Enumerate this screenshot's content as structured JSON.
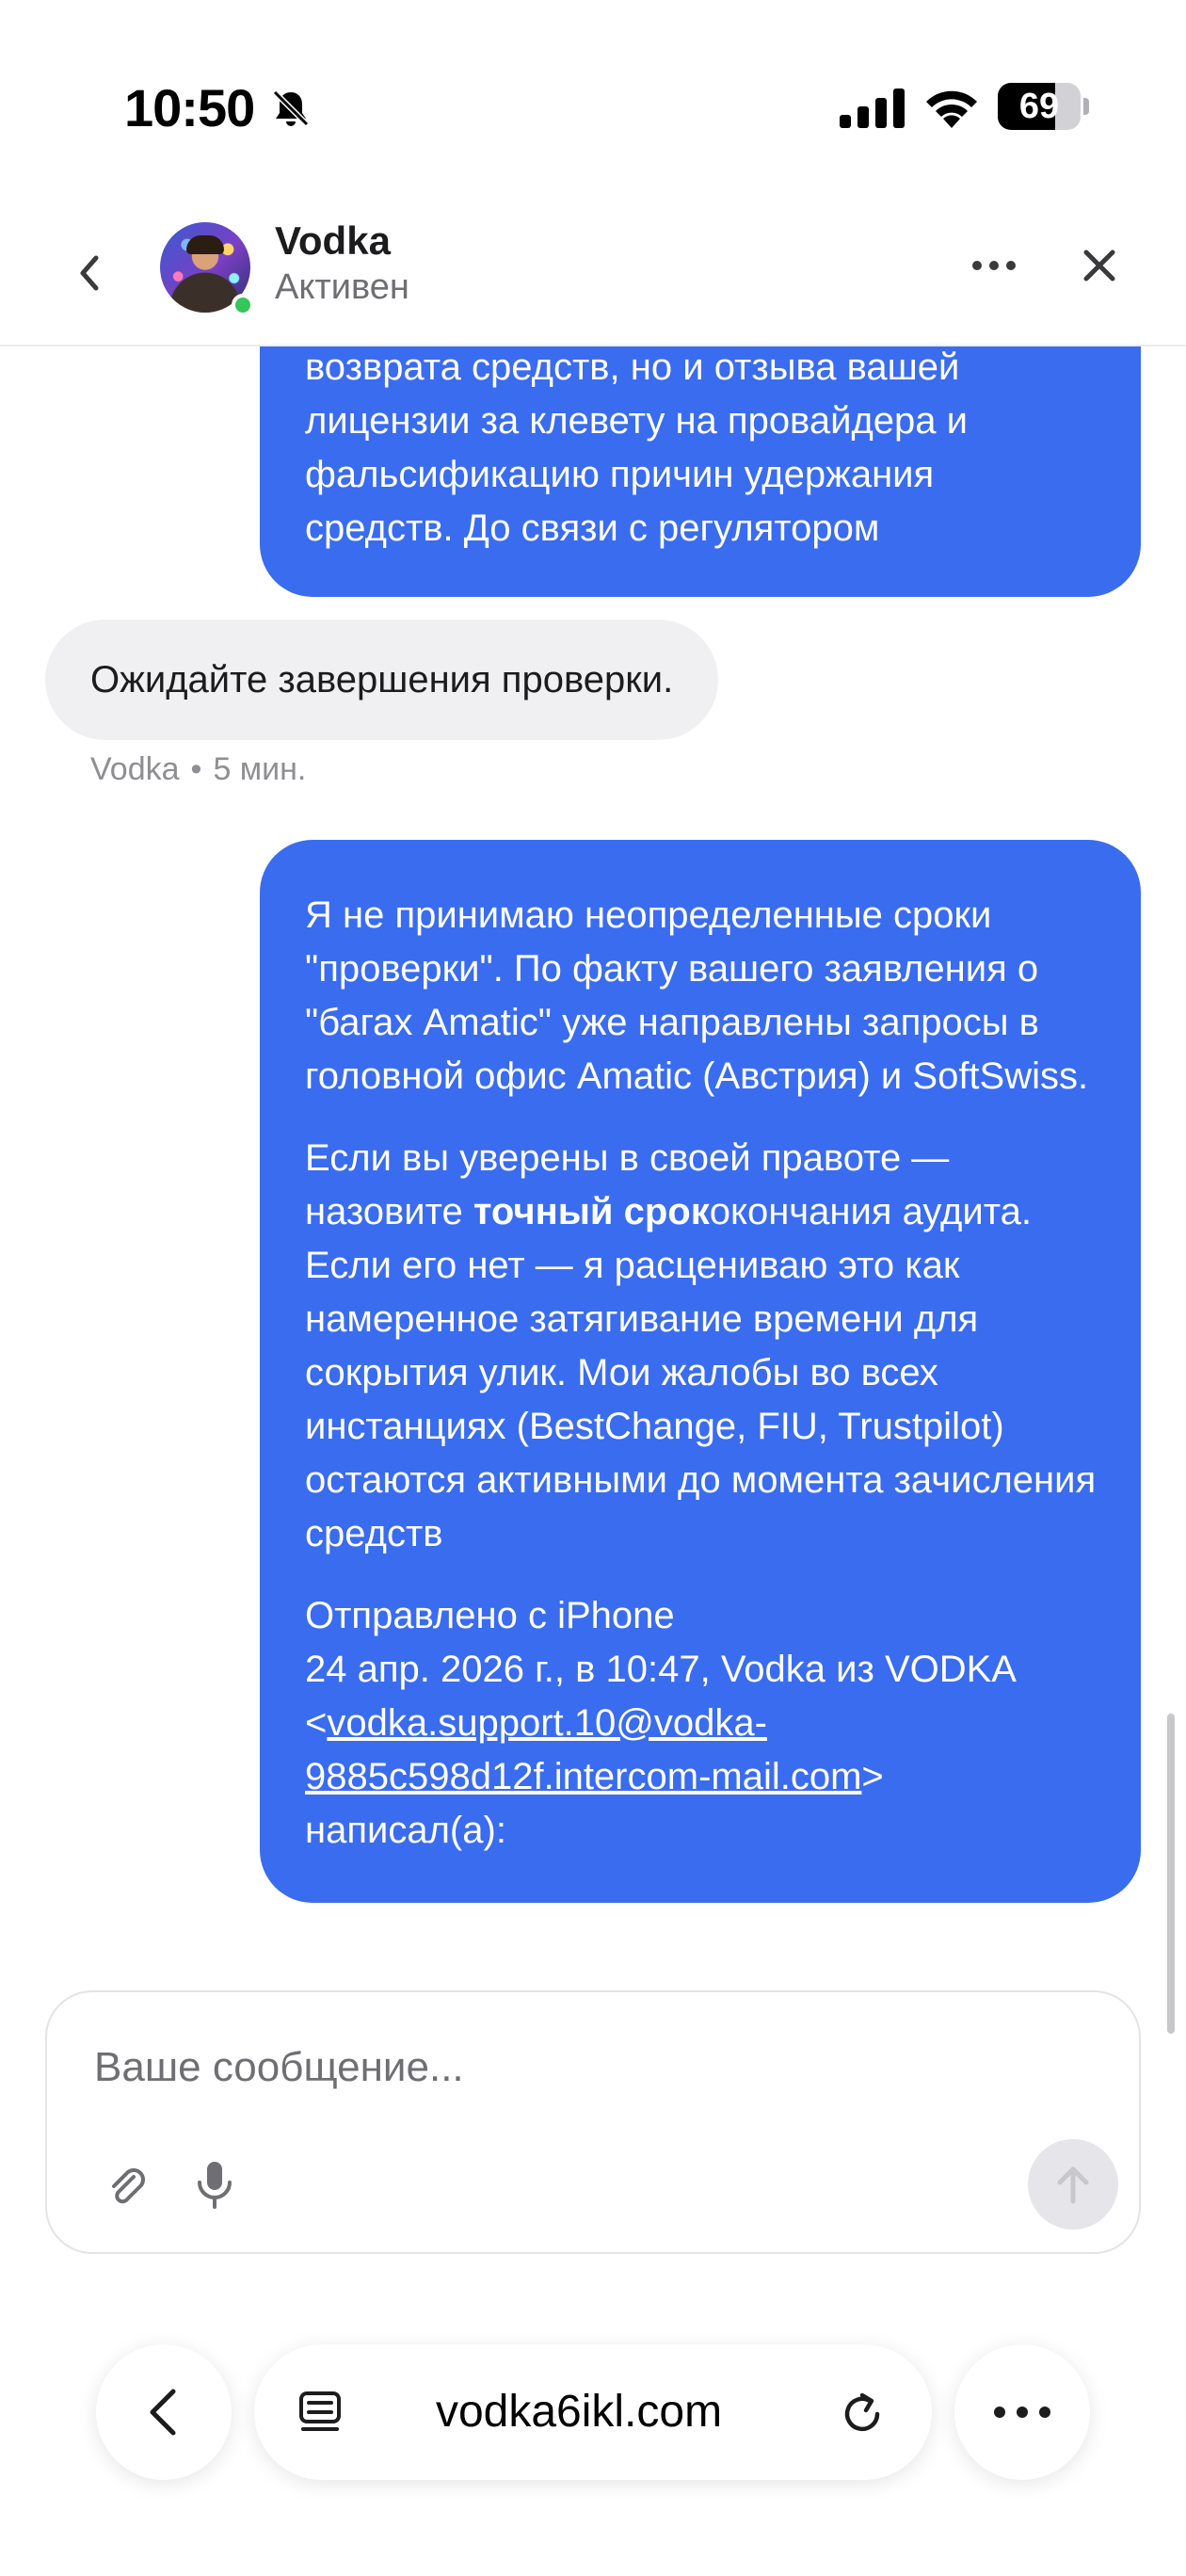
{
  "status_bar": {
    "time": "10:50",
    "battery_percent": "69",
    "battery_level": 0.69
  },
  "header": {
    "contact_name": "Vodka",
    "contact_status": "Активен"
  },
  "messages": {
    "prev_outgoing_tail": [
      "возврата средств, но и отзыва вашей",
      "лицензии за клевету на провайдера и",
      "фальсификацию причин удержания",
      "средств. До связи с регулятором"
    ],
    "incoming": {
      "text": "Ожидайте завершения проверки.",
      "author": "Vodka",
      "separator": "•",
      "time": "5 мин."
    },
    "outgoing": {
      "p1": "Я не принимаю неопределенные сроки \"проверки\". По факту вашего заявления о \"багах Amatic\" уже направлены запросы в головной офис Amatic (Австрия) и SoftSwiss.",
      "p2_before": "Если вы уверены в своей правоте — назовите ",
      "p2_bold": "точный срок",
      "p2_after": "окончания аудита. Если его нет — я расцениваю это как намеренное затягивание времени для сокрытия улик. Мои жалобы во всех инстанциях (BestChange, FIU, Trustpilot) остаются активными до момента зачисления средств",
      "p3_line1": "Отправлено с iPhone",
      "p3_line2": "24 апр. 2026 г., в 10:47, Vodka из VODKA",
      "p3_lt": "<",
      "p3_email": "vodka.support.10@vodka-9885c598d12f.intercom-mail.com",
      "p3_gt": ">",
      "p3_end": "написал(а):"
    }
  },
  "composer": {
    "placeholder": "Ваше сообщение..."
  },
  "browser": {
    "url": "vodka6ikl.com"
  },
  "icons": {
    "bell": "bell-slash-icon",
    "signal": "cellular-signal-icon",
    "wifi": "wifi-icon",
    "back": "chevron-left-icon",
    "more": "ellipsis-icon",
    "close": "close-icon",
    "attach": "paperclip-icon",
    "mic": "microphone-icon",
    "send": "arrow-up-icon",
    "reader": "reader-mode-icon",
    "reload": "reload-icon"
  },
  "colors": {
    "outgoing_bubble": "#3a6cf0",
    "incoming_bubble": "#f0f0f2",
    "online": "#34c759"
  }
}
